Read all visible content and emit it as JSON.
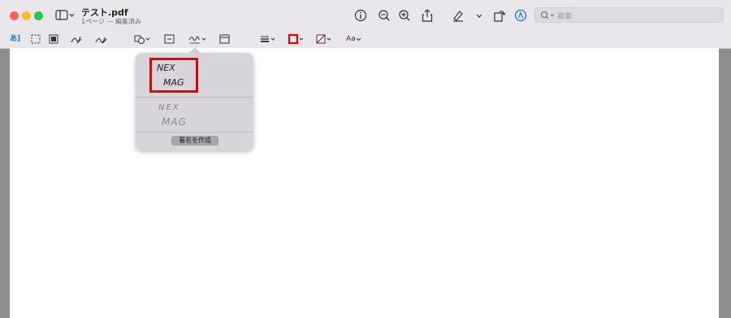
{
  "window": {
    "title": "テスト.pdf",
    "subtitle": "1ページ — 編集済み"
  },
  "search": {
    "placeholder": "検索"
  },
  "markup_toolbar": {
    "text_selection_label": "あ",
    "font_label": "Aa"
  },
  "signature_popover": {
    "signatures": [
      {
        "line1": "NEX",
        "line2": "MAG"
      },
      {
        "line1": "NEX",
        "line2": "MAG"
      }
    ],
    "create_button": "署名を作成"
  },
  "colors": {
    "highlight": "#e60000",
    "accent": "#1a73e8"
  }
}
